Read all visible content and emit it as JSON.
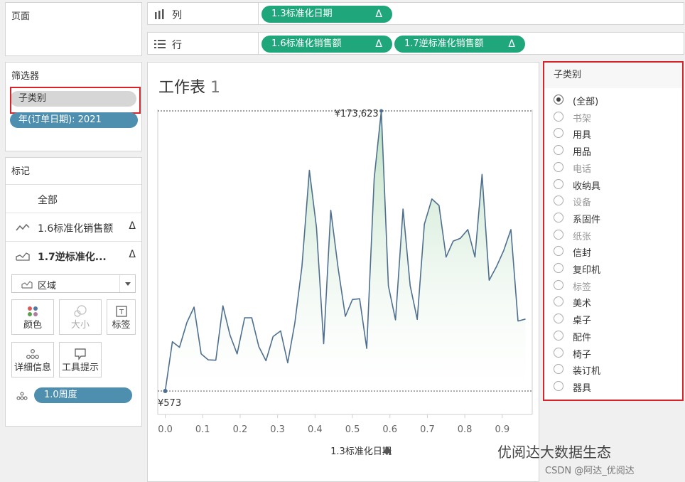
{
  "pages": {
    "title": "页面"
  },
  "filters": {
    "title": "筛选器",
    "items": [
      {
        "label": "子类别"
      },
      {
        "label": "年(订单日期): 2021"
      }
    ]
  },
  "marks": {
    "title": "标记",
    "all_label": "全部",
    "rows": [
      {
        "label": "1.6标准化销售额",
        "delta": "Δ"
      },
      {
        "label": "1.7逆标准化...",
        "delta": "Δ"
      }
    ],
    "mark_type": "区域",
    "buttons": {
      "color": "颜色",
      "size": "大小",
      "label": "标签",
      "detail": "详细信息",
      "tooltip": "工具提示"
    },
    "detail_pill": "1.0周度"
  },
  "shelves": {
    "columns": {
      "label": "列",
      "pills": [
        {
          "label": "1.3标准化日期",
          "delta": "Δ"
        }
      ]
    },
    "rows": {
      "label": "行",
      "pills": [
        {
          "label": "1.6标准化销售额",
          "delta": "Δ"
        },
        {
          "label": "1.7逆标准化销售额",
          "delta": "Δ"
        }
      ]
    }
  },
  "worksheet": {
    "title": "工作表",
    "title_num": "1"
  },
  "chart_data": {
    "type": "area",
    "xlabel": "1.3标准化日期",
    "x_ticks": [
      "0.0",
      "0.1",
      "0.2",
      "0.3",
      "0.4",
      "0.5",
      "0.6",
      "0.7",
      "0.8",
      "0.9"
    ],
    "xlim": [
      -0.02,
      0.98
    ],
    "max_label": "¥173,623",
    "min_label": "¥573",
    "series": [
      {
        "x": [
          0.0,
          0.019,
          0.038,
          0.058,
          0.077,
          0.096,
          0.115,
          0.135,
          0.154,
          0.173,
          0.192,
          0.212,
          0.231,
          0.25,
          0.269,
          0.288,
          0.308,
          0.327,
          0.346,
          0.365,
          0.385,
          0.404,
          0.423,
          0.442,
          0.462,
          0.481,
          0.5,
          0.519,
          0.538,
          0.558,
          0.577,
          0.596,
          0.615,
          0.635,
          0.654,
          0.673,
          0.692,
          0.712,
          0.731,
          0.75,
          0.769,
          0.788,
          0.808,
          0.827,
          0.846,
          0.865,
          0.885,
          0.904,
          0.923,
          0.942,
          0.962
        ],
        "y": [
          573,
          31000,
          27600,
          43000,
          52400,
          23500,
          19800,
          19600,
          53200,
          35100,
          23500,
          45800,
          45800,
          27900,
          19300,
          34200,
          37700,
          18000,
          42500,
          77400,
          136900,
          101500,
          29800,
          112200,
          76000,
          46700,
          57100,
          57600,
          26900,
          132000,
          173623,
          65500,
          44500,
          113000,
          65700,
          44800,
          103600,
          119200,
          115200,
          83300,
          93200,
          94900,
          100300,
          83300,
          134400,
          69000,
          77600,
          87400,
          100300,
          43800,
          45000
        ]
      }
    ],
    "grid": false,
    "fill": "#d6ecd9",
    "line_color": "#4f6f8f"
  },
  "filter_card": {
    "title": "子类别",
    "selected": "(全部)",
    "options": [
      {
        "label": "(全部)",
        "selected": true,
        "dim": false
      },
      {
        "label": "书架",
        "selected": false,
        "dim": true
      },
      {
        "label": "用具",
        "selected": false,
        "dim": false
      },
      {
        "label": "用品",
        "selected": false,
        "dim": false
      },
      {
        "label": "电话",
        "selected": false,
        "dim": true
      },
      {
        "label": "收纳具",
        "selected": false,
        "dim": false
      },
      {
        "label": "设备",
        "selected": false,
        "dim": true
      },
      {
        "label": "系固件",
        "selected": false,
        "dim": false
      },
      {
        "label": "纸张",
        "selected": false,
        "dim": true
      },
      {
        "label": "信封",
        "selected": false,
        "dim": false
      },
      {
        "label": "复印机",
        "selected": false,
        "dim": false
      },
      {
        "label": "标签",
        "selected": false,
        "dim": true
      },
      {
        "label": "美术",
        "selected": false,
        "dim": false
      },
      {
        "label": "桌子",
        "selected": false,
        "dim": false
      },
      {
        "label": "配件",
        "selected": false,
        "dim": false
      },
      {
        "label": "椅子",
        "selected": false,
        "dim": false
      },
      {
        "label": "装订机",
        "selected": false,
        "dim": false
      },
      {
        "label": "器具",
        "selected": false,
        "dim": false
      }
    ]
  },
  "watermark": {
    "main": "优阅达大数据生态",
    "sub": "CSDN @阿达_优阅达"
  },
  "colors": {
    "green_pill": "#1fa67a",
    "blue_pill": "#4e8fb0",
    "highlight": "#d9232a"
  }
}
